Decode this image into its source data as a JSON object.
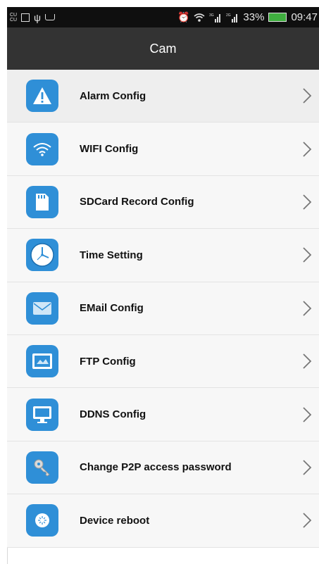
{
  "status_bar": {
    "carrier": "CU",
    "battery_percent": "33%",
    "time": "09:47",
    "net_1": "3G",
    "net_2": "2G"
  },
  "title": "Cam",
  "menu": [
    {
      "label": "Alarm Config",
      "icon": "alarm-warning-icon"
    },
    {
      "label": "WIFI Config",
      "icon": "wifi-icon"
    },
    {
      "label": "SDCard Record Config",
      "icon": "sdcard-icon"
    },
    {
      "label": "Time Setting",
      "icon": "clock-icon"
    },
    {
      "label": "EMail Config",
      "icon": "email-icon"
    },
    {
      "label": "FTP Config",
      "icon": "ftp-icon"
    },
    {
      "label": "DDNS Config",
      "icon": "monitor-icon"
    },
    {
      "label": "Change P2P access password",
      "icon": "key-icon"
    },
    {
      "label": "Device reboot",
      "icon": "reboot-icon"
    }
  ],
  "colors": {
    "accent": "#2f8fd7",
    "titlebar": "#333333",
    "statusbar": "#0f0f0f"
  }
}
